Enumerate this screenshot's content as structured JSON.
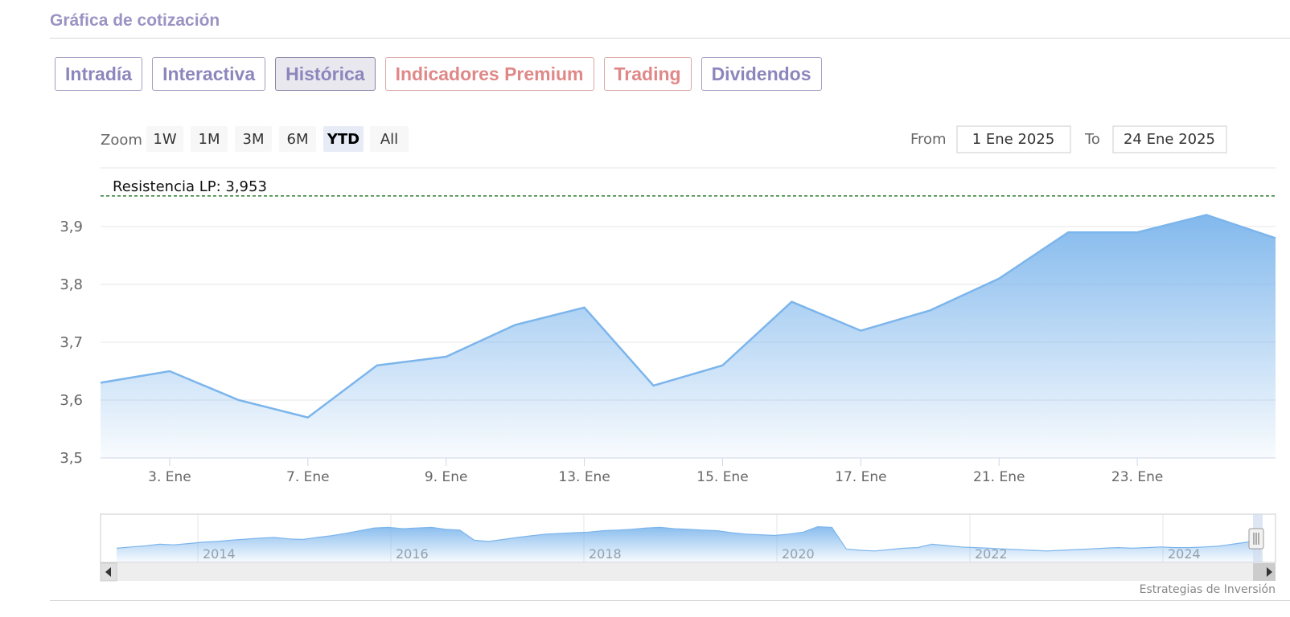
{
  "section_title": "Gráfica de cotización",
  "tabs": [
    {
      "label": "Intradía",
      "kind": "normal"
    },
    {
      "label": "Interactiva",
      "kind": "normal"
    },
    {
      "label": "Histórica",
      "kind": "active"
    },
    {
      "label": "Indicadores Premium",
      "kind": "premium"
    },
    {
      "label": "Trading",
      "kind": "premium"
    },
    {
      "label": "Dividendos",
      "kind": "normal"
    }
  ],
  "range_selector": {
    "zoom_label": "Zoom",
    "buttons": [
      "1W",
      "1M",
      "3M",
      "6M",
      "YTD",
      "All"
    ],
    "selected": "YTD",
    "from_label": "From",
    "from_value": "1 Ene 2025",
    "to_label": "To",
    "to_value": "24 Ene 2025"
  },
  "credits": "Estrategias de Inversión",
  "colors": {
    "line": "#7cb5ec",
    "fill_top": "#7cb5ec",
    "resistance": "#2e7d32",
    "tab_text": "#8d86bd",
    "premium_text": "#e08888"
  },
  "chart_data": {
    "type": "area",
    "x": [
      "2 Ene",
      "3 Ene",
      "6 Ene",
      "7 Ene",
      "8 Ene",
      "9 Ene",
      "10 Ene",
      "13 Ene",
      "14 Ene",
      "15 Ene",
      "16 Ene",
      "17 Ene",
      "20 Ene",
      "21 Ene",
      "22 Ene",
      "23 Ene",
      "24 Ene"
    ],
    "values": [
      3.63,
      3.65,
      3.6,
      3.57,
      3.66,
      3.675,
      3.73,
      3.76,
      3.625,
      3.66,
      3.77,
      3.72,
      3.755,
      3.81,
      3.89,
      3.89,
      3.92
    ],
    "last_value": 3.88,
    "ylim": [
      3.5,
      3.95
    ],
    "y_ticks": [
      "3,5",
      "3,6",
      "3,7",
      "3,8",
      "3,9"
    ],
    "y_tick_values": [
      3.5,
      3.6,
      3.7,
      3.8,
      3.9
    ],
    "x_ticks": [
      "3. Ene",
      "7. Ene",
      "9. Ene",
      "13. Ene",
      "15. Ene",
      "17. Ene",
      "21. Ene",
      "23. Ene"
    ],
    "x_tick_indices": [
      1,
      3,
      5,
      7,
      9,
      11,
      13,
      15
    ],
    "resistance": {
      "label": "Resistencia LP: 3,953",
      "value": 3.953
    },
    "grid": true,
    "legend": "none",
    "navigator": {
      "year_labels": [
        "2014",
        "2016",
        "2018",
        "2020",
        "2022",
        "2024"
      ],
      "values": [
        0.18,
        0.22,
        0.25,
        0.3,
        0.28,
        0.32,
        0.36,
        0.38,
        0.42,
        0.45,
        0.48,
        0.5,
        0.46,
        0.44,
        0.5,
        0.55,
        0.62,
        0.7,
        0.78,
        0.8,
        0.76,
        0.78,
        0.8,
        0.74,
        0.72,
        0.42,
        0.38,
        0.44,
        0.5,
        0.55,
        0.6,
        0.62,
        0.64,
        0.66,
        0.7,
        0.72,
        0.74,
        0.78,
        0.8,
        0.76,
        0.74,
        0.72,
        0.7,
        0.64,
        0.6,
        0.58,
        0.56,
        0.6,
        0.66,
        0.82,
        0.8,
        0.16,
        0.12,
        0.1,
        0.14,
        0.18,
        0.2,
        0.3,
        0.26,
        0.22,
        0.2,
        0.18,
        0.16,
        0.14,
        0.12,
        0.1,
        0.12,
        0.14,
        0.16,
        0.18,
        0.2,
        0.18,
        0.2,
        0.22,
        0.2,
        0.2,
        0.22,
        0.24,
        0.3,
        0.36,
        0.48
      ]
    }
  }
}
